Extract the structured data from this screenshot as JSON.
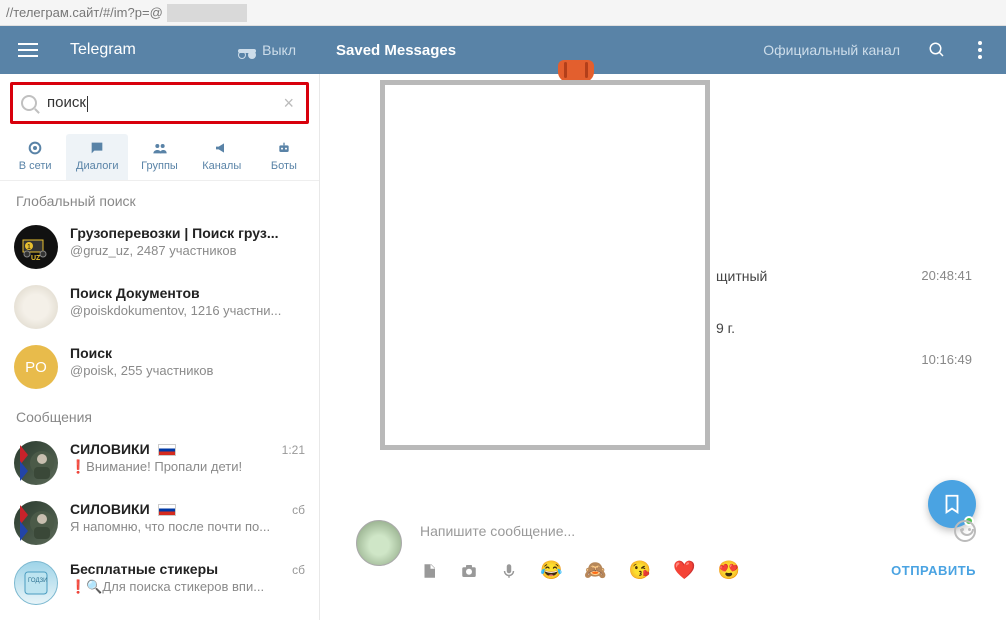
{
  "address": "//телеграм.сайт/#/im?p=@",
  "header": {
    "brand": "Telegram",
    "vykl": "Выкл",
    "title": "Saved Messages",
    "channel_link": "Официальный канал"
  },
  "search": {
    "value": "поиск"
  },
  "tabs": [
    {
      "label": "В сети"
    },
    {
      "label": "Диалоги"
    },
    {
      "label": "Группы"
    },
    {
      "label": "Каналы"
    },
    {
      "label": "Боты"
    }
  ],
  "sections": {
    "global": "Глобальный поиск",
    "messages": "Сообщения"
  },
  "global_results": [
    {
      "title_pre": "Грузоперевозки | ",
      "title_hl": "Поиск",
      "title_post": " груз...",
      "sub": "@gruz_uz, 2487 участников"
    },
    {
      "title_pre": "",
      "title_hl": "Поиск",
      "title_post": " Документов",
      "sub": "@poiskdokumentov, 1216 участни..."
    },
    {
      "title_pre": "",
      "title_hl": "Поиск",
      "title_post": "",
      "sub": "@poisk, 255 участников",
      "avatar_text": "PO"
    }
  ],
  "message_results": [
    {
      "title": "СИЛОВИКИ",
      "flag": true,
      "time": "1:21",
      "sub": "❗Внимание! Пропали дети!"
    },
    {
      "title": "СИЛОВИКИ",
      "flag": true,
      "time": "сб",
      "sub": "Я напомню, что после почти по..."
    },
    {
      "title": "Бесплатные стикеры",
      "flag": false,
      "time": "сб",
      "sub_pre": "❗🔍Для ",
      "sub_hl": "поиска",
      "sub_post": " стикеров впи..."
    }
  ],
  "chat": {
    "snippet1": "щитный",
    "time1": "20:48:41",
    "snippet2": "9 г.",
    "time2": "10:16:49"
  },
  "composer": {
    "placeholder": "Напишите сообщение...",
    "send": "ОТПРАВИТЬ",
    "emojis": [
      "😂",
      "🙈",
      "😘",
      "❤️",
      "😍"
    ]
  }
}
